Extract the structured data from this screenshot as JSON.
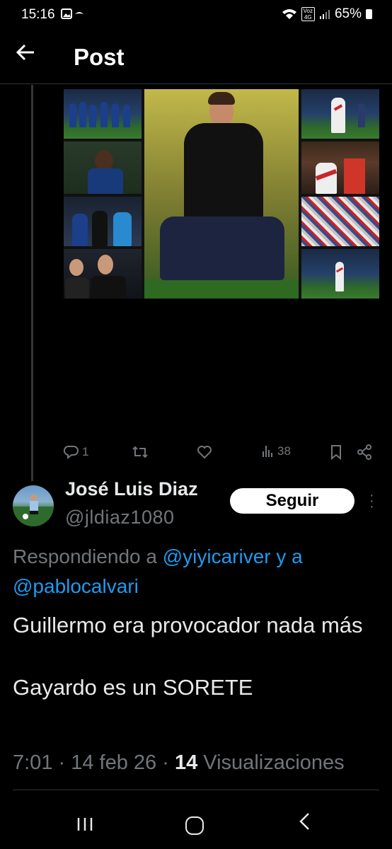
{
  "status_bar": {
    "time": "15:16",
    "network": "4G",
    "volte": "Voz",
    "battery": "65%"
  },
  "header": {
    "title": "Post"
  },
  "actions": {
    "replies": "1",
    "retweets": "",
    "likes": "",
    "views": "38"
  },
  "reply": {
    "name": "José Luis Diaz",
    "handle": "@jldiaz1080",
    "follow_label": "Seguir",
    "replying_prefix": "Respondiendo a",
    "mention_1": "@yiyicariver",
    "connector": "y a",
    "mention_2": "@pablocalvari",
    "text_line1": "Guillermo era provocador nada más",
    "text_line2": "Gayardo es un SORETE",
    "time": "7:01",
    "date": "14 feb 26",
    "views_count": "14",
    "views_label": "Visualizaciones"
  },
  "colors": {
    "background": "#000000",
    "accent": "#1d9bf0",
    "muted": "#71767b",
    "text": "#e7e9ea"
  }
}
